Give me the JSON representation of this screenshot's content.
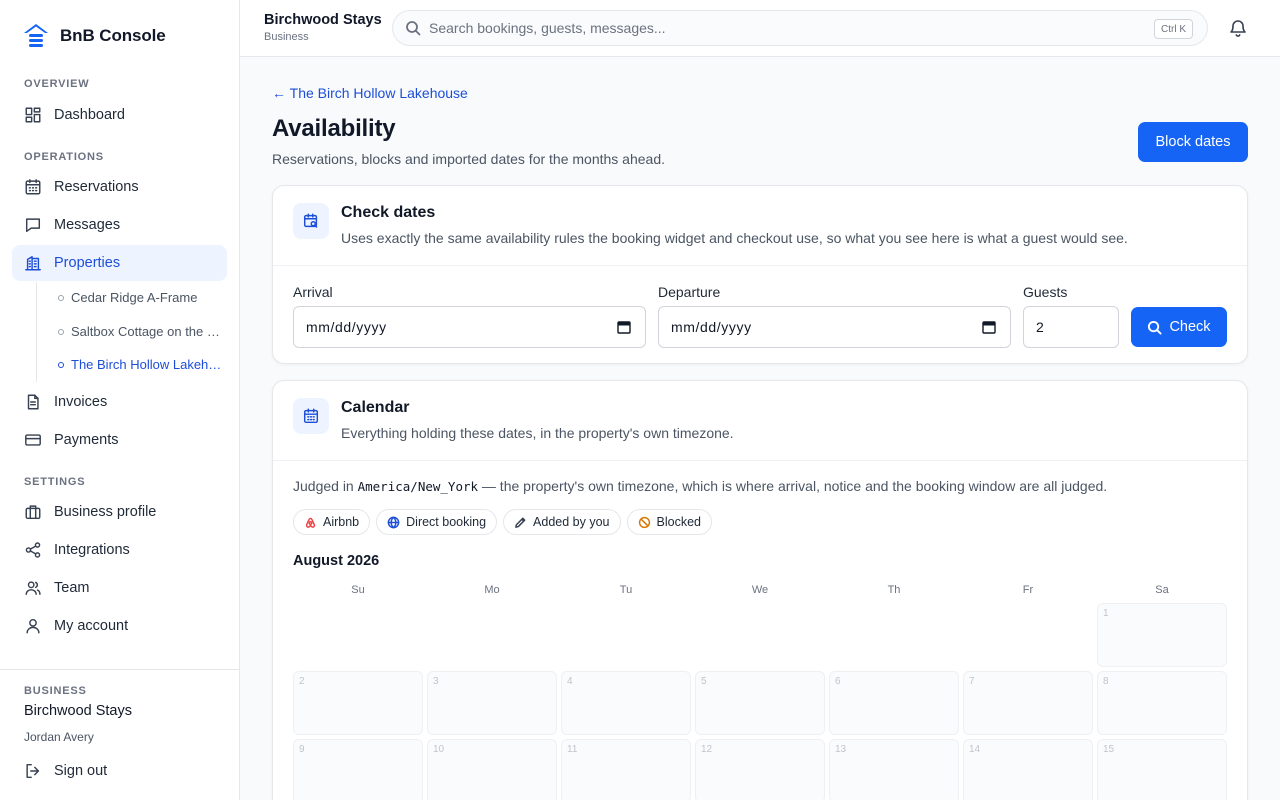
{
  "app": {
    "name": "BnB Console"
  },
  "sidebar": {
    "sections": {
      "overview": "OVERVIEW",
      "operations": "OPERATIONS",
      "settings": "SETTINGS"
    },
    "items": {
      "dashboard": "Dashboard",
      "reservations": "Reservations",
      "messages": "Messages",
      "properties": "Properties",
      "invoices": "Invoices",
      "payments": "Payments",
      "business_profile": "Business profile",
      "integrations": "Integrations",
      "team": "Team",
      "my_account": "My account"
    },
    "properties": [
      "Cedar Ridge A-Frame",
      "Saltbox Cottage on the Marsh",
      "The Birch Hollow Lakehouse"
    ],
    "footer": {
      "label": "BUSINESS",
      "business": "Birchwood Stays",
      "user": "Jordan Avery",
      "signout": "Sign out"
    }
  },
  "topbar": {
    "workspace": "Birchwood Stays",
    "workspace_type": "Business",
    "search_placeholder": "Search bookings, guests, messages...",
    "shortcut": "Ctrl K"
  },
  "page": {
    "back": "← The Birch Hollow Lakehouse",
    "title": "Availability",
    "subtitle": "Reservations, blocks and imported dates for the months ahead.",
    "block_button": "Block dates"
  },
  "check": {
    "title": "Check dates",
    "desc": "Uses exactly the same availability rules the booking widget and checkout use, so what you see here is what a guest would see.",
    "arrival_label": "Arrival",
    "arrival_value": "mm/dd/yyyy",
    "departure_label": "Departure",
    "departure_value": "mm/dd/yyyy",
    "guests_label": "Guests",
    "guests_value": "2",
    "button": "Check"
  },
  "calendar": {
    "title": "Calendar",
    "desc": "Everything holding these dates, in the property's own timezone.",
    "tz_prefix": "Judged in",
    "tz": "America/New_York",
    "tz_suffix": "— the property's own timezone, which is where arrival, notice and the booking window are all judged.",
    "legend": [
      "Airbnb",
      "Direct booking",
      "Added by you",
      "Blocked"
    ],
    "month": "August 2026",
    "weekdays": [
      "Su",
      "Mo",
      "Tu",
      "We",
      "Th",
      "Fr",
      "Sa"
    ],
    "days": [
      "1",
      "2",
      "3",
      "4",
      "5",
      "6",
      "7",
      "8",
      "9",
      "10",
      "11",
      "12",
      "13",
      "14",
      "15"
    ]
  },
  "colors": {
    "accent": "#1664f5",
    "active_bg": "#eef4ff",
    "airbnb": "#ef4444",
    "blocked": "#d97706"
  }
}
